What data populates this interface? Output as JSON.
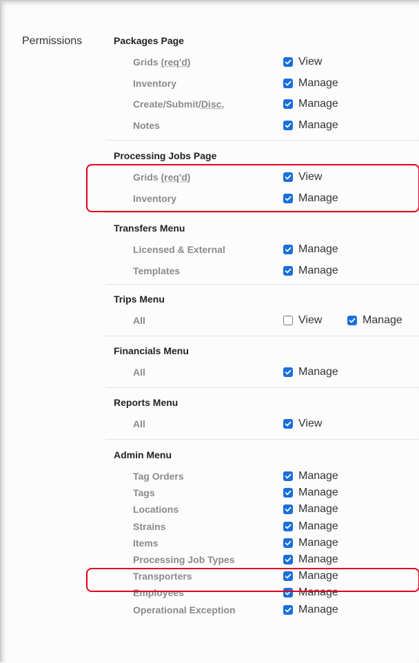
{
  "permissions_label": "Permissions",
  "check_color": "#1a6fd9",
  "highlight_color": "#e0001b",
  "sections": [
    {
      "title": "Packages Page",
      "rows": [
        {
          "pre": "Grids ",
          "abbr": "(req'd)",
          "post": "",
          "options": [
            {
              "label": "View",
              "checked": true
            }
          ]
        },
        {
          "pre": "Inventory",
          "abbr": "",
          "post": "",
          "options": [
            {
              "label": "Manage",
              "checked": true
            }
          ]
        },
        {
          "pre": "Create/Submit/",
          "abbr": "Disc.",
          "post": "",
          "options": [
            {
              "label": "Manage",
              "checked": true
            }
          ]
        },
        {
          "pre": "Notes",
          "abbr": "",
          "post": "",
          "options": [
            {
              "label": "Manage",
              "checked": true
            }
          ]
        }
      ]
    },
    {
      "title": "Processing Jobs Page",
      "rows": [
        {
          "pre": "Grids ",
          "abbr": "(req'd)",
          "post": "",
          "options": [
            {
              "label": "View",
              "checked": true
            }
          ]
        },
        {
          "pre": "Inventory",
          "abbr": "",
          "post": "",
          "options": [
            {
              "label": "Manage",
              "checked": true
            }
          ]
        }
      ]
    },
    {
      "title": "Transfers Menu",
      "rows": [
        {
          "pre": "Licensed & External",
          "abbr": "",
          "post": "",
          "options": [
            {
              "label": "Manage",
              "checked": true
            }
          ]
        },
        {
          "pre": "Templates",
          "abbr": "",
          "post": "",
          "options": [
            {
              "label": "Manage",
              "checked": true
            }
          ]
        }
      ]
    },
    {
      "title": "Trips Menu",
      "rows": [
        {
          "pre": "All",
          "abbr": "",
          "post": "",
          "options": [
            {
              "label": "View",
              "checked": false
            },
            {
              "label": "Manage",
              "checked": true
            }
          ]
        }
      ]
    },
    {
      "title": "Financials Menu",
      "rows": [
        {
          "pre": "All",
          "abbr": "",
          "post": "",
          "options": [
            {
              "label": "Manage",
              "checked": true
            }
          ]
        }
      ]
    },
    {
      "title": "Reports Menu",
      "rows": [
        {
          "pre": "All",
          "abbr": "",
          "post": "",
          "options": [
            {
              "label": "View",
              "checked": true
            }
          ]
        }
      ]
    },
    {
      "title": "Admin Menu",
      "rows": [
        {
          "pre": "Tag Orders",
          "abbr": "",
          "post": "",
          "options": [
            {
              "label": "Manage",
              "checked": true
            }
          ]
        },
        {
          "pre": "Tags",
          "abbr": "",
          "post": "",
          "options": [
            {
              "label": "Manage",
              "checked": true
            }
          ]
        },
        {
          "pre": "Locations",
          "abbr": "",
          "post": "",
          "options": [
            {
              "label": "Manage",
              "checked": true
            }
          ]
        },
        {
          "pre": "Strains",
          "abbr": "",
          "post": "",
          "options": [
            {
              "label": "Manage",
              "checked": true
            }
          ]
        },
        {
          "pre": "Items",
          "abbr": "",
          "post": "",
          "options": [
            {
              "label": "Manage",
              "checked": true
            }
          ]
        },
        {
          "pre": "Processing Job Types",
          "abbr": "",
          "post": "",
          "options": [
            {
              "label": "Manage",
              "checked": true
            }
          ]
        },
        {
          "pre": "Transporters",
          "abbr": "",
          "post": "",
          "options": [
            {
              "label": "Manage",
              "checked": true
            }
          ]
        },
        {
          "pre": "Employees",
          "abbr": "",
          "post": "",
          "options": [
            {
              "label": "Manage",
              "checked": true
            }
          ]
        },
        {
          "pre": "Operational Exception",
          "abbr": "",
          "post": "",
          "options": [
            {
              "label": "Manage",
              "checked": true
            }
          ]
        }
      ]
    }
  ]
}
